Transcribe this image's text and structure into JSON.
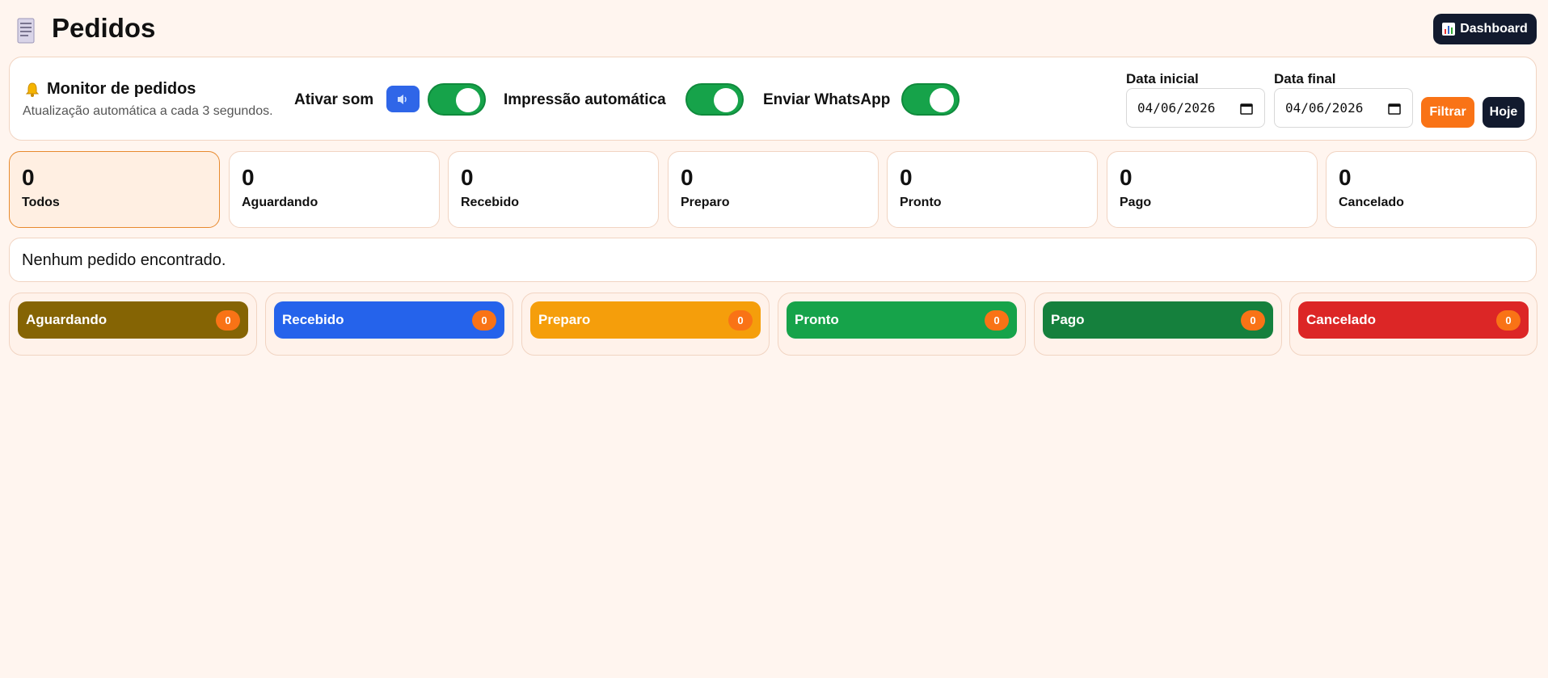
{
  "header": {
    "title": "Pedidos",
    "icon": "receipt-icon",
    "dashboard_label": "Dashboard"
  },
  "monitor": {
    "title": "Monitor de pedidos",
    "subtitle": "Atualização automática a cada 3 segundos.",
    "sound_label": "Ativar som",
    "sound_enabled": true,
    "print_label": "Impressão automática",
    "print_enabled": true,
    "whatsapp_label": "Enviar WhatsApp",
    "whatsapp_enabled": true,
    "start_date_label": "Data inicial",
    "start_date": "04/06/2026",
    "end_date_label": "Data final",
    "end_date": "04/06/2026",
    "filter_label": "Filtrar",
    "today_label": "Hoje"
  },
  "status_cards": [
    {
      "count": "0",
      "label": "Todos"
    },
    {
      "count": "0",
      "label": "Aguardando"
    },
    {
      "count": "0",
      "label": "Recebido"
    },
    {
      "count": "0",
      "label": "Preparo"
    },
    {
      "count": "0",
      "label": "Pronto"
    },
    {
      "count": "0",
      "label": "Pago"
    },
    {
      "count": "0",
      "label": "Cancelado"
    }
  ],
  "empty_message": "Nenhum pedido encontrado.",
  "columns": [
    {
      "name": "Aguardando",
      "count": "0",
      "color": "#856404"
    },
    {
      "name": "Recebido",
      "count": "0",
      "color": "#2563eb"
    },
    {
      "name": "Preparo",
      "count": "0",
      "color": "#f59e0b"
    },
    {
      "name": "Pronto",
      "count": "0",
      "color": "#16a34a"
    },
    {
      "name": "Pago",
      "count": "0",
      "color": "#15803d"
    },
    {
      "name": "Cancelado",
      "count": "0",
      "color": "#dc2626"
    }
  ],
  "colors": {
    "accent": "#f97316",
    "dark": "#121a2e",
    "toggle_on": "#16a34a",
    "background": "#fff5ef"
  }
}
